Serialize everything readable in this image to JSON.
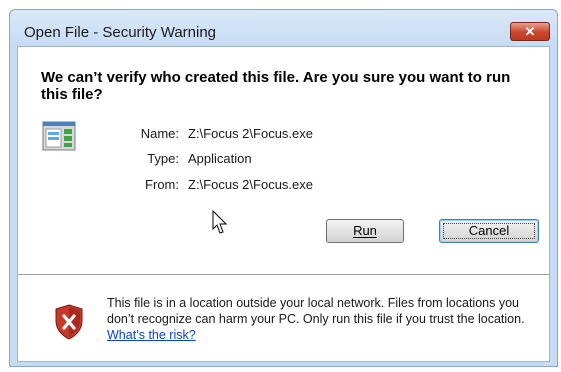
{
  "window": {
    "title": "Open File - Security Warning",
    "close_label": "✕"
  },
  "dialog": {
    "headline": "We can’t verify who created this file. Are you sure you want to run this file?",
    "fields": [
      {
        "label": "Name:",
        "value": "Z:\\Focus 2\\Focus.exe"
      },
      {
        "label": "Type:",
        "value": "Application"
      },
      {
        "label": "From:",
        "value": "Z:\\Focus 2\\Focus.exe"
      }
    ],
    "buttons": {
      "run_label": "Run",
      "cancel_label": "Cancel"
    },
    "warning": {
      "text": "This file is in a location outside your local network. Files from locations you don’t recognize can harm your PC. Only run this file if you trust the location. ",
      "link_text": "What’s the risk?"
    }
  },
  "icons": {
    "file": "application-file-icon",
    "shield": "security-shield-icon",
    "cursor": "mouse-cursor-icon"
  },
  "colors": {
    "window_frame": "#c5dcf5",
    "close_button": "#c8462c",
    "link": "#0645c8"
  }
}
